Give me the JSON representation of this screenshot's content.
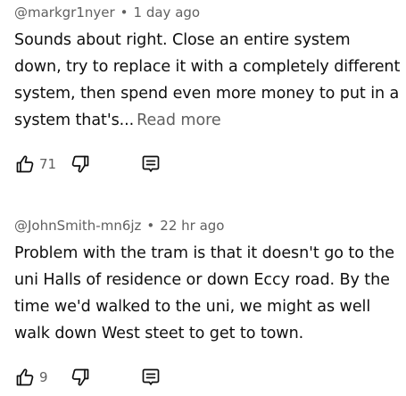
{
  "comments": [
    {
      "author": "@markgr1nyer",
      "separator": "•",
      "time": "1 day ago",
      "text": "Sounds about right. Close an entire system down, try to replace it with a completely different system, then spend even more money to put in a system that's...",
      "read_more": "Read more",
      "likes": "71",
      "icons": [
        "thumbs-up-icon",
        "thumbs-down-icon",
        "reply-icon"
      ]
    },
    {
      "author": "@JohnSmith-mn6jz",
      "separator": "•",
      "time": "22 hr ago",
      "text": "Problem with the tram is that it doesn't go to the uni Halls of residence or down Eccy road. By the time we'd walked to the uni, we might as well walk down West steet to get to town.",
      "likes": "9",
      "icons": [
        "thumbs-up-icon",
        "thumbs-down-icon",
        "reply-icon"
      ]
    }
  ],
  "colors": {
    "text": "#0f0f0f",
    "meta": "#606060",
    "background": "#ffffff"
  }
}
